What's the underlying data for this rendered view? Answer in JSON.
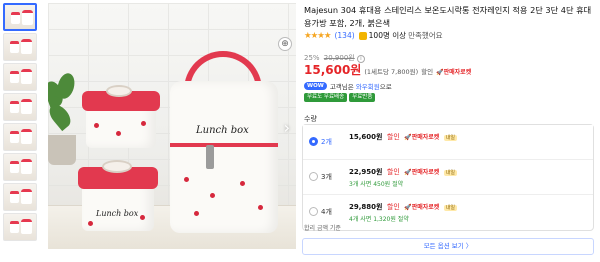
{
  "product": {
    "title": "Majesun 304 휴대용 스테인리스 보온도시락통 전자레인지 적용 2단 3단 4단 휴대용가방 포함, 2개, 붉은색",
    "stars": "★★★★",
    "review_count": "(134)",
    "satisfaction_badge": "100명 이상",
    "satisfaction_text": "만족했어요"
  },
  "pricing": {
    "discount_rate": "25%",
    "original_price": "20,900원",
    "sale_price": "15,600원",
    "unit_price": "(1세트당 7,800원)",
    "discount_tag": "할인",
    "rocket_label": "🚀판매자로켓",
    "wow_badge": "WOW",
    "wow_text_prefix": "고객님은",
    "wow_text_link": "와우회원",
    "wow_text_suffix": "으로",
    "shipping_chips": [
      "무료도 무료배송",
      "무료반품"
    ]
  },
  "options": {
    "label": "수량",
    "items": [
      {
        "name": "2개",
        "price": "15,600원",
        "discount": "할인",
        "rocket": "🚀판매자로켓",
        "tag": "내일",
        "sub": "",
        "selected": true
      },
      {
        "name": "3개",
        "price": "22,950원",
        "discount": "할인",
        "rocket": "🚀판매자로켓",
        "tag": "내일",
        "sub": "3개 사면 450원 절약",
        "selected": false
      },
      {
        "name": "4개",
        "price": "29,880원",
        "discount": "할인",
        "rocket": "🚀판매자로켓",
        "tag": "내일",
        "sub": "4개 사면 1,320원 절약",
        "selected": false
      }
    ],
    "more_link": "합리 금액 기준",
    "all_button": "모든 옵션 보기 〉"
  },
  "image": {
    "box_label_small": "Lunch box",
    "box_label_large": "Lunch box",
    "zoom_icon": "⊕",
    "next_icon": "›"
  },
  "colors": {
    "accent_blue": "#346aff",
    "price_red": "#e52528",
    "lid_red": "#e2394f",
    "ship_green": "#2f9a3a"
  }
}
